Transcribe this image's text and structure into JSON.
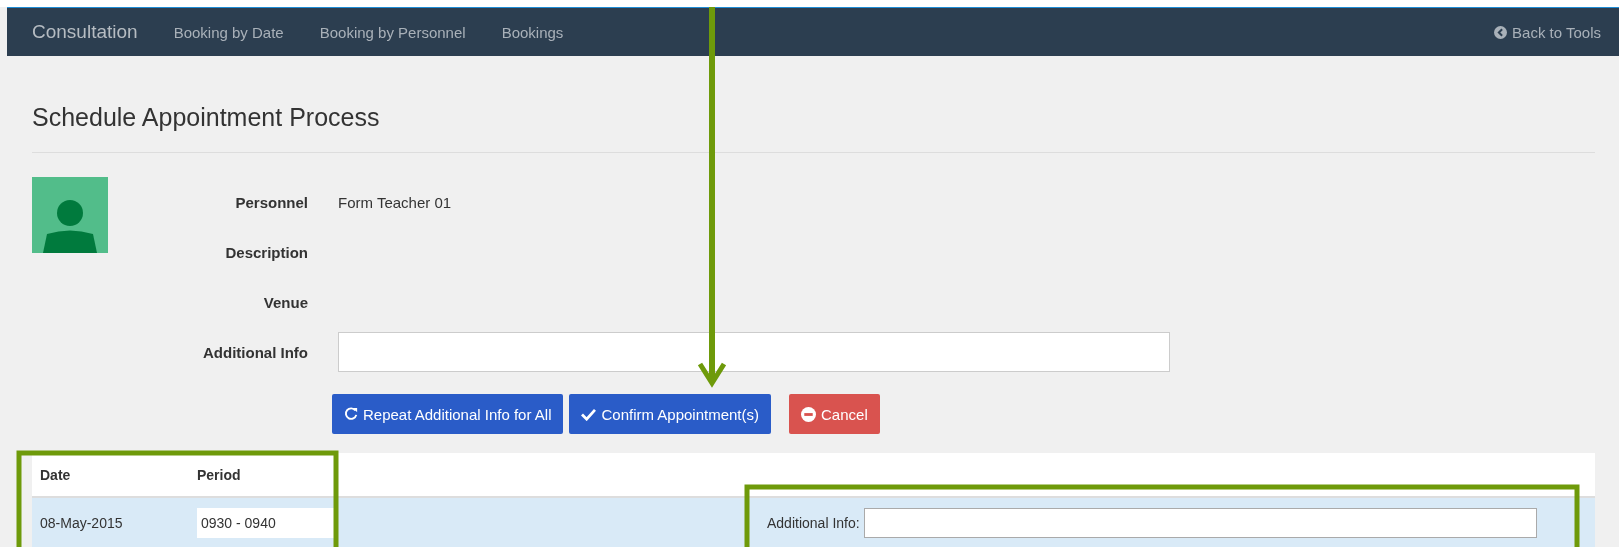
{
  "navbar": {
    "brand": "Consultation",
    "links": [
      {
        "label": "Booking by Date",
        "selected": false
      },
      {
        "label": "Booking by Personnel",
        "selected": false
      },
      {
        "label": "Bookings",
        "selected": false
      }
    ],
    "back_link": "Back to Tools"
  },
  "heading": "Schedule Appointment Process",
  "details": [
    {
      "label": "Personnel",
      "value": "Form Teacher 01",
      "kind": "text"
    },
    {
      "label": "Description",
      "kind": "text"
    },
    {
      "label": "Venue",
      "kind": "text"
    },
    {
      "label": "Additional Info",
      "kind": "input"
    }
  ],
  "buttons": [
    {
      "label": "Repeat Additional Info for All",
      "kind": "repeat"
    },
    {
      "label": "Confirm Appointment(s)",
      "kind": "confirm"
    },
    {
      "label": "Cancel",
      "kind": "cancel"
    }
  ],
  "table": {
    "columns": [
      "Date",
      "Period"
    ],
    "rows": [
      {
        "date": "08-May-2015",
        "period": "0930 - 0940",
        "info_label": "Additional Info:",
        "selected": true
      }
    ]
  }
}
